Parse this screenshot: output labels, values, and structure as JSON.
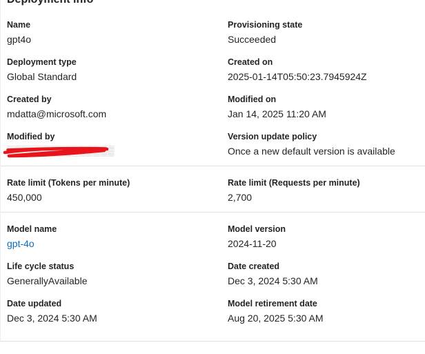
{
  "section": {
    "title": "Deployment info"
  },
  "fields": {
    "name": {
      "label": "Name",
      "value": "gpt4o"
    },
    "provisioning_state": {
      "label": "Provisioning state",
      "value": "Succeeded"
    },
    "deployment_type": {
      "label": "Deployment type",
      "value": "Global Standard"
    },
    "created_on": {
      "label": "Created on",
      "value": "2025-01-14T05:50:23.7945924Z"
    },
    "created_by": {
      "label": "Created by",
      "value": "mdatta@microsoft.com"
    },
    "modified_on": {
      "label": "Modified on",
      "value": "Jan 14, 2025 11:20 AM"
    },
    "modified_by": {
      "label": "Modified by",
      "value": ""
    },
    "version_update_policy": {
      "label": "Version update policy",
      "value": "Once a new default version is available"
    },
    "rate_limit_tokens": {
      "label": "Rate limit (Tokens per minute)",
      "value": "450,000"
    },
    "rate_limit_requests": {
      "label": "Rate limit (Requests per minute)",
      "value": "2,700"
    },
    "model_name": {
      "label": "Model name",
      "value": "gpt-4o"
    },
    "model_version": {
      "label": "Model version",
      "value": "2024-11-20"
    },
    "life_cycle_status": {
      "label": "Life cycle status",
      "value": "GenerallyAvailable"
    },
    "date_created": {
      "label": "Date created",
      "value": "Dec 3, 2024 5:30 AM"
    },
    "date_updated": {
      "label": "Date updated",
      "value": "Dec 3, 2024 5:30 AM"
    },
    "model_retirement_date": {
      "label": "Model retirement date",
      "value": "Aug 20, 2025 5:30 AM"
    }
  },
  "colors": {
    "link": "#0f6cbd",
    "redaction": "#e8141c",
    "divider": "#e1e1e1"
  }
}
